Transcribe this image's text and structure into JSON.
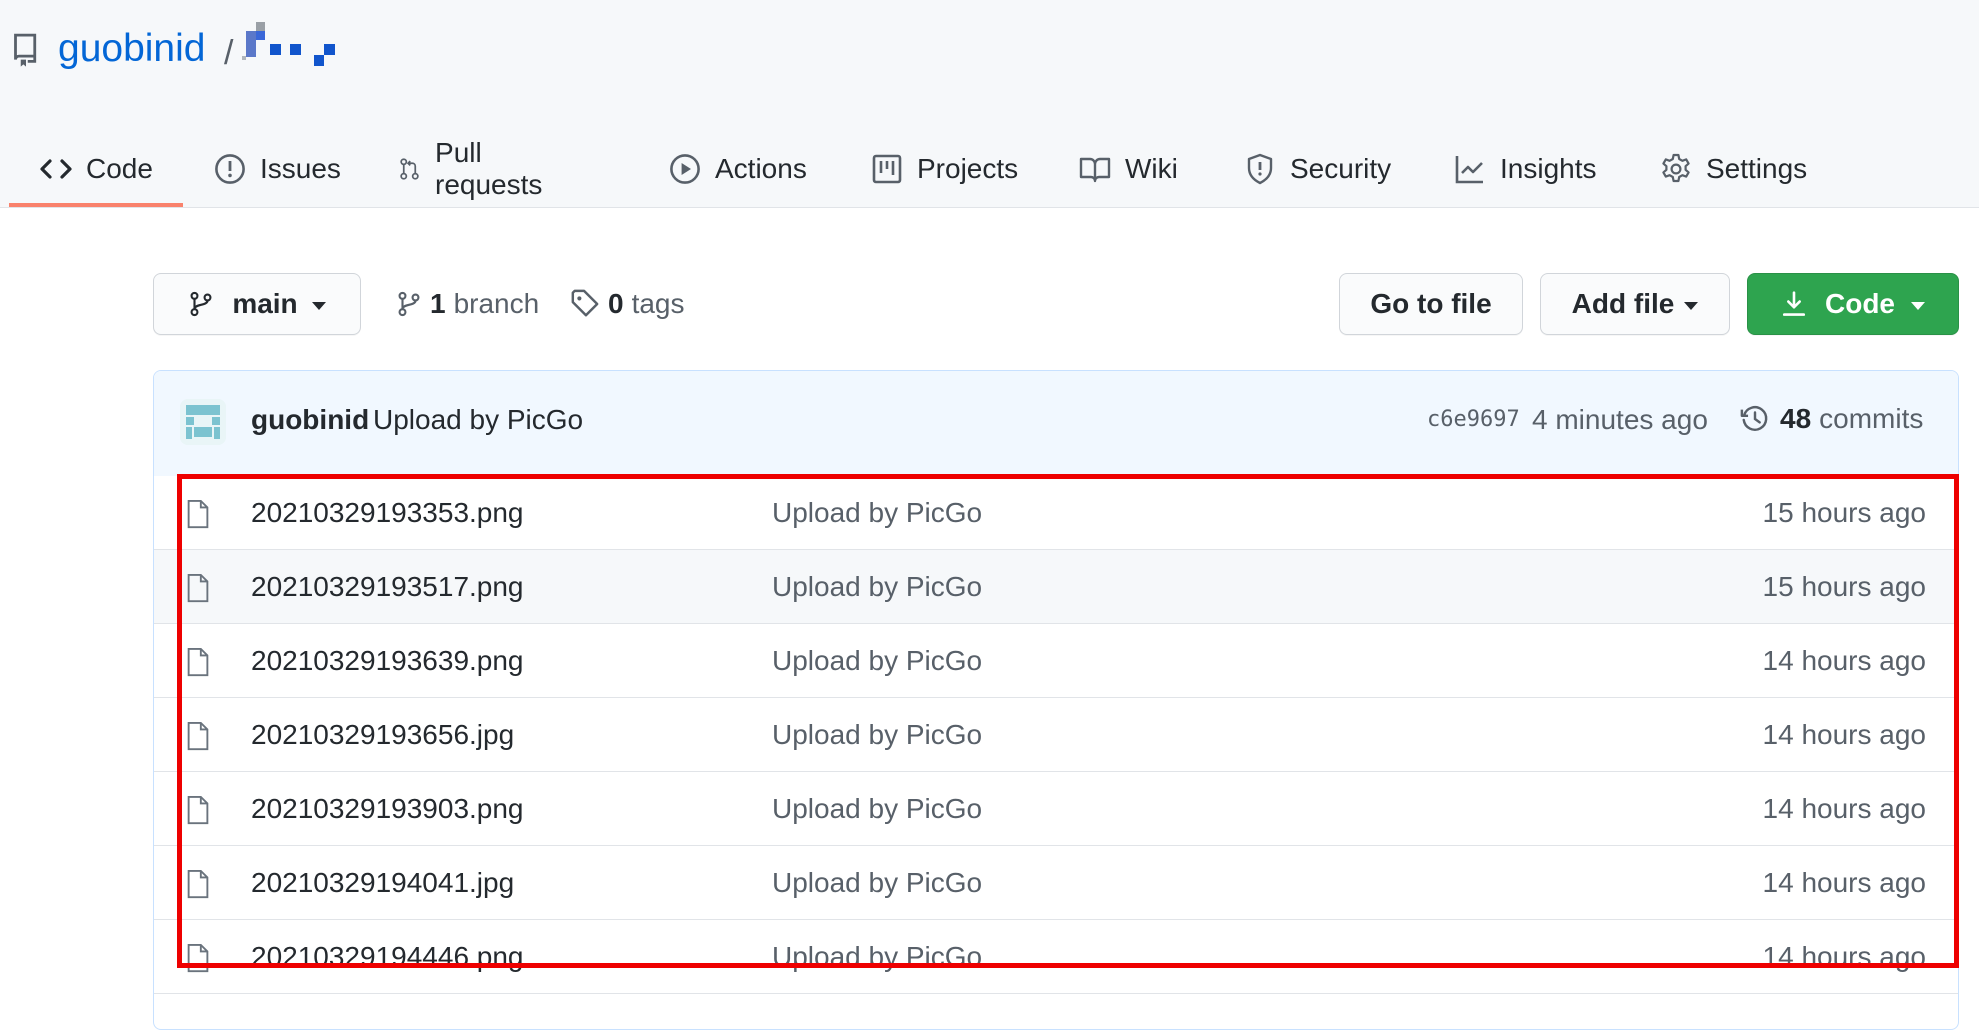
{
  "repo": {
    "owner": "guobinid",
    "separator": "/"
  },
  "tabs": [
    {
      "label": "Code",
      "icon": "code-icon",
      "selected": true
    },
    {
      "label": "Issues",
      "icon": "issue-icon"
    },
    {
      "label": "Pull requests",
      "icon": "pull-request-icon"
    },
    {
      "label": "Actions",
      "icon": "play-icon"
    },
    {
      "label": "Projects",
      "icon": "project-icon"
    },
    {
      "label": "Wiki",
      "icon": "book-icon"
    },
    {
      "label": "Security",
      "icon": "shield-icon"
    },
    {
      "label": "Insights",
      "icon": "graph-icon"
    },
    {
      "label": "Settings",
      "icon": "gear-icon"
    }
  ],
  "toolbar": {
    "branch_select": "main",
    "branch_count": "1",
    "branch_label": "branch",
    "tag_count": "0",
    "tag_label": "tags",
    "go_to_file": "Go to file",
    "add_file": "Add file",
    "code": "Code"
  },
  "latest_commit": {
    "author": "guobinid",
    "message": "Upload by PicGo",
    "sha": "c6e9697",
    "age": "4 minutes ago",
    "count": "48",
    "count_label": "commits"
  },
  "files": [
    {
      "name": "20210329193353.png",
      "message": "Upload by PicGo",
      "age": "15 hours ago"
    },
    {
      "name": "20210329193517.png",
      "message": "Upload by PicGo",
      "age": "15 hours ago"
    },
    {
      "name": "20210329193639.png",
      "message": "Upload by PicGo",
      "age": "14 hours ago"
    },
    {
      "name": "20210329193656.jpg",
      "message": "Upload by PicGo",
      "age": "14 hours ago"
    },
    {
      "name": "20210329193903.png",
      "message": "Upload by PicGo",
      "age": "14 hours ago"
    },
    {
      "name": "20210329194041.jpg",
      "message": "Upload by PicGo",
      "age": "14 hours ago"
    },
    {
      "name": "20210329194446.png",
      "message": "Upload by PicGo",
      "age": "14 hours ago"
    }
  ],
  "colors": {
    "link": "#0366d6",
    "primary_button": "#2ea44f",
    "selected_tab_underline": "#f9826c",
    "annotation_box": "#ee0000"
  }
}
